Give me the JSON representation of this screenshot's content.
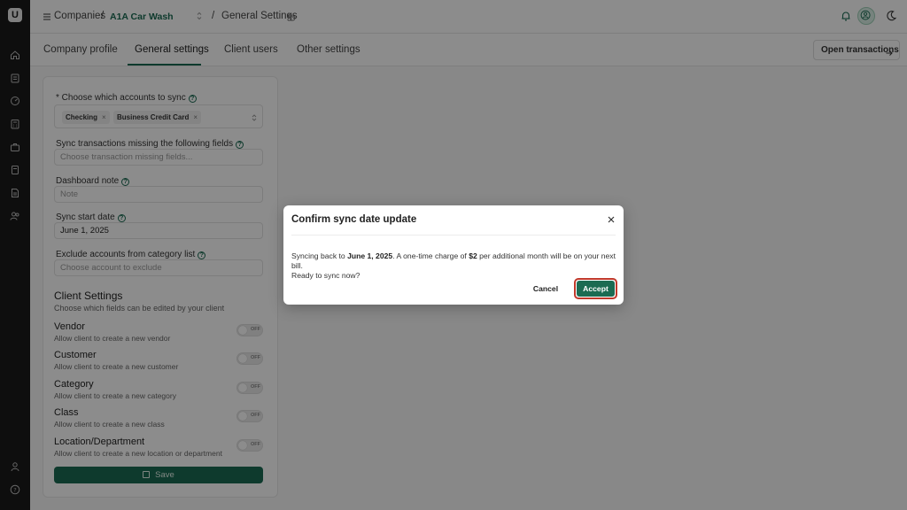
{
  "app": {
    "logo_text": "U"
  },
  "header": {
    "companies_label": "Companies",
    "separator": "/",
    "company_name": "A1A Car Wash",
    "page_crumb": "General Settings",
    "icons": [
      "menu-icon",
      "updown-icon",
      "undo-icon",
      "bell-icon",
      "avatar",
      "moon-icon"
    ]
  },
  "tabs": [
    {
      "label": "Company profile",
      "active": false
    },
    {
      "label": "General settings",
      "active": true
    },
    {
      "label": "Client users",
      "active": false
    },
    {
      "label": "Other settings",
      "active": false
    }
  ],
  "open_transactions": {
    "label": "Open transactions"
  },
  "form": {
    "accounts_to_sync": {
      "label": "* Choose which accounts to sync",
      "chips": [
        "Checking",
        "Business Credit Card"
      ]
    },
    "missing_fields": {
      "label": "Sync transactions missing the following fields",
      "placeholder": "Choose transaction missing fields..."
    },
    "dashboard_note": {
      "label": "Dashboard note",
      "placeholder": "Note"
    },
    "sync_start_date": {
      "label": "Sync start date",
      "value": "June 1, 2025"
    },
    "exclude_accounts": {
      "label": "Exclude accounts from category list",
      "placeholder": "Choose account to exclude"
    }
  },
  "client_settings": {
    "title": "Client Settings",
    "subtitle": "Choose which fields can be edited by your client",
    "toggle_off_text": "OFF",
    "rows": [
      {
        "title": "Vendor",
        "sub": "Allow client to create a new vendor",
        "on": false
      },
      {
        "title": "Customer",
        "sub": "Allow client to create a new customer",
        "on": false
      },
      {
        "title": "Category",
        "sub": "Allow client to create a new category",
        "on": false
      },
      {
        "title": "Class",
        "sub": "Allow client to create a new class",
        "on": false
      },
      {
        "title": "Location/Department",
        "sub": "Allow client to create a new location or department",
        "on": false
      }
    ]
  },
  "save": {
    "label": "Save"
  },
  "modal": {
    "title": "Confirm sync date update",
    "body_prefix": "Syncing back to ",
    "body_date": "June 1, 2025",
    "body_middle": ". A one-time charge of ",
    "body_amount": "$2",
    "body_suffix": " per additional month will be on your next bill.",
    "body_line2": "Ready to sync now?",
    "cancel_label": "Cancel",
    "accept_label": "Accept"
  },
  "colors": {
    "brand": "#1b6b52",
    "rail": "#1a1a1a",
    "highlight": "#c0392b"
  }
}
